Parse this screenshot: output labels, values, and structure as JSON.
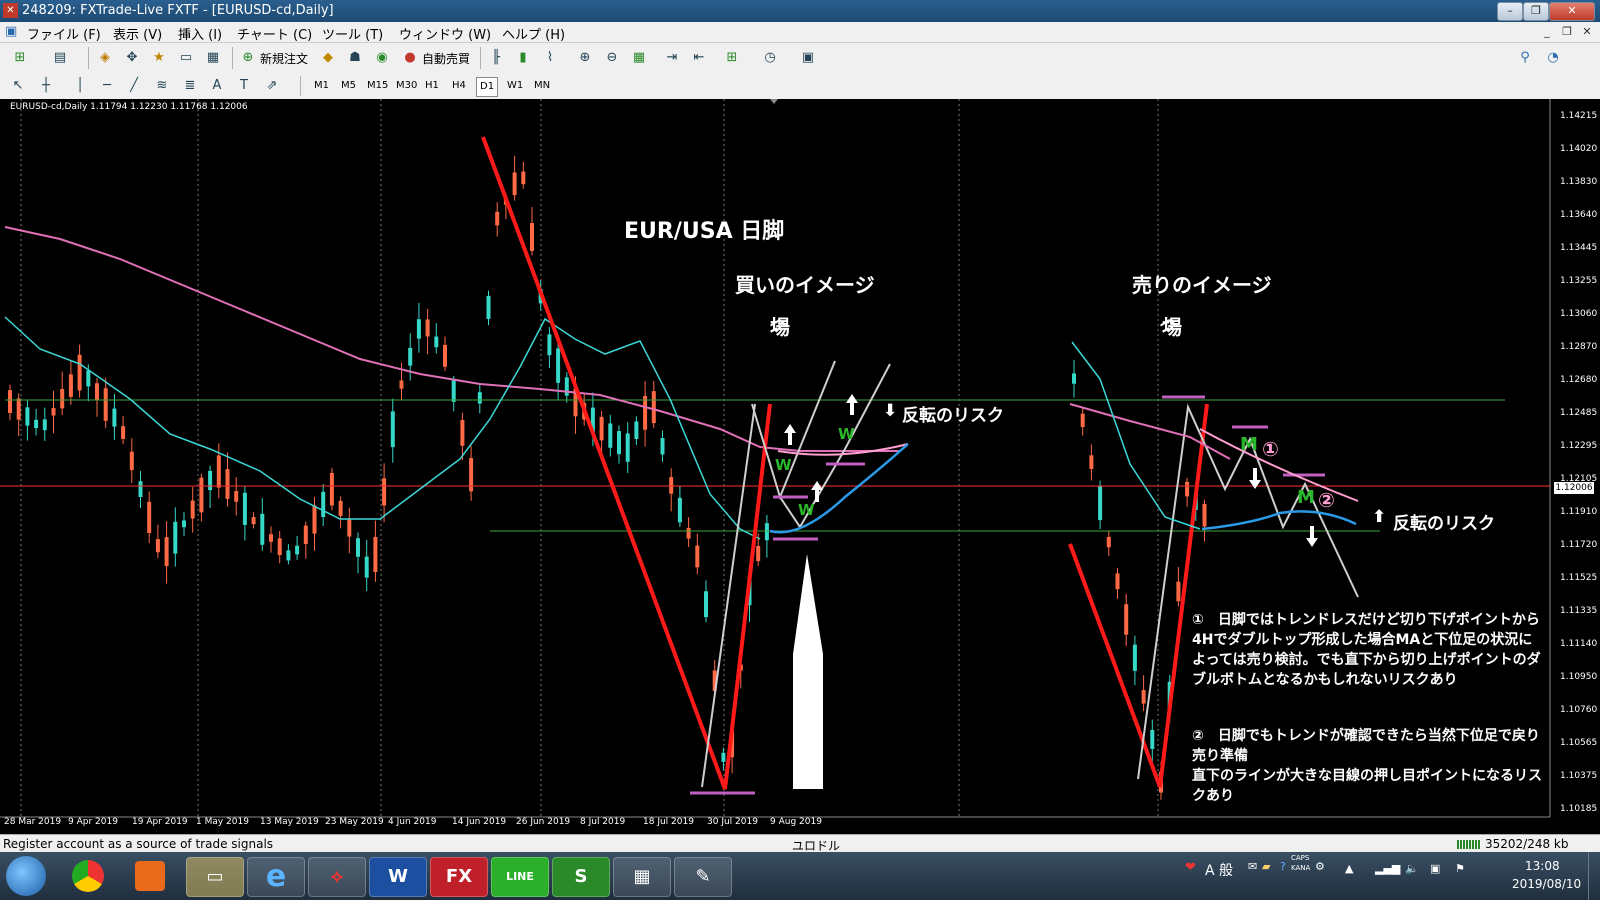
{
  "window": {
    "title": "248209: FXTrade-Live FXTF - [EURUSD-cd,Daily]",
    "app_icon": "mt4-logo-icon",
    "minimize": "–",
    "restore": "❐",
    "close": "✕"
  },
  "menu": [
    "ファイル (F)",
    "表示 (V)",
    "挿入 (I)",
    "チャート (C)",
    "ツール (T)",
    "ウィンドウ (W)",
    "ヘルプ (H)"
  ],
  "toolbar": {
    "new_order": "新規注文",
    "auto_trading": "自動売買",
    "timeframes": [
      "M1",
      "M5",
      "M15",
      "M30",
      "H1",
      "H4",
      "D1",
      "W1",
      "MN"
    ],
    "active_timeframe": "D1"
  },
  "chart": {
    "info": "EURUSD-cd,Daily  1.11794 1.12230 1.11768 1.12006",
    "current_price": "1.12006",
    "price_labels": [
      "1.14215",
      "1.14020",
      "1.13830",
      "1.13640",
      "1.13445",
      "1.13255",
      "1.13060",
      "1.12870",
      "1.12680",
      "1.12485",
      "1.12295",
      "1.12105",
      "1.11910",
      "1.11720",
      "1.11525",
      "1.11335",
      "1.11140",
      "1.10950",
      "1.10760",
      "1.10565",
      "1.10375",
      "1.10185"
    ],
    "date_labels": [
      "28 Mar 2019",
      "9 Apr 2019",
      "19 Apr 2019",
      "1 May 2019",
      "13 May 2019",
      "23 May 2019",
      "4 Jun 2019",
      "14 Jun 2019",
      "26 Jun 2019",
      "8 Jul 2019",
      "18 Jul 2019",
      "30 Jul 2019",
      "9 Aug 2019"
    ],
    "colors": {
      "bull": "#36d8c8",
      "bear": "#ff6a45",
      "ma_fast": "#3cd8d8",
      "ma_slow": "#e070b8",
      "trend": "#ff1a1a",
      "hline": "#3aa83a",
      "bid": "#ff3030"
    }
  },
  "annotations": {
    "title": "EUR/USA 日脚",
    "buy_image": "買いのイメージ",
    "buy_ba": "場",
    "sell_image": "売りのイメージ",
    "sell_ba": "場",
    "reversal_risk_left": "反転のリスク",
    "reversal_risk_right": "反転のリスク",
    "w_label": "W",
    "m_label": "M",
    "circle1": "①",
    "circle2": "②",
    "note1": "①　日脚ではトレンドレスだけど切り下げポイントから4Hでダブルトップ形成した場合MAと下位足の状況によっては売り検討。でも直下から切り上げポイントのダブルボトムとなるかもしれないリスクあり",
    "note2": "②　日脚でもトレンドが確認できたら当然下位足で戻り売り準備",
    "note3": "直下のラインが大きな目線の押し目ポイントになるリスクあり"
  },
  "status": {
    "left": "Register account as a source of trade signals",
    "middle": "ユロドル",
    "right": "35202/248 kb"
  },
  "taskbar": {
    "apps": [
      "windows-start-icon",
      "chrome-icon",
      "media-player-icon",
      "file-explorer-icon",
      "internet-explorer-icon",
      "acrobat-icon",
      "word-icon",
      "fx-icon",
      "line-icon",
      "sheets-icon",
      "calculator-icon",
      "paint-icon"
    ],
    "word_label": "W",
    "fx_label": "FX",
    "line_label": "LINE",
    "s_label": "S",
    "ime": "A 般",
    "caps": "CAPS",
    "kana": "KANA",
    "time": "13:08",
    "date": "2019/08/10"
  }
}
